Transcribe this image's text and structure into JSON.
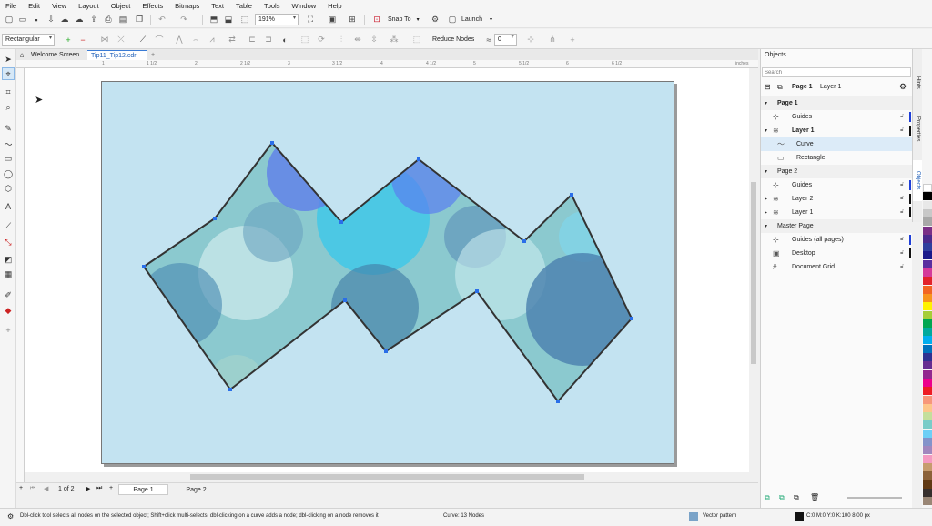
{
  "menu": [
    "File",
    "Edit",
    "View",
    "Layout",
    "Object",
    "Effects",
    "Bitmaps",
    "Text",
    "Table",
    "Tools",
    "Window",
    "Help"
  ],
  "toolbar": {
    "zoom_value": "191%",
    "snap_to": "Snap To",
    "launch": "Launch"
  },
  "propertybar": {
    "selection_mode": "Rectangular",
    "reduce_nodes": "Reduce Nodes",
    "smoothness_value": "0"
  },
  "doc_tabs": [
    "Welcome Screen",
    "Tip11_Tip12.cdr"
  ],
  "ruler": {
    "ticks": [
      "1",
      "1 1/2",
      "2",
      "2 1/2",
      "3",
      "3 1/2",
      "4",
      "4 1/2",
      "5",
      "5 1/2",
      "6",
      "6 1/2"
    ],
    "units": "inches"
  },
  "page_nav": {
    "counter": "1 of 2",
    "tabs": [
      "Page 1",
      "Page 2"
    ]
  },
  "objects_panel": {
    "title": "Objects",
    "search_placeholder": "Search",
    "header_page": "Page 1",
    "header_layer": "Layer 1",
    "rows": [
      {
        "label": "Page 1",
        "bold": true,
        "arrow": "▾",
        "icon": ""
      },
      {
        "label": "Guides",
        "bold": false,
        "arrow": "",
        "icon": "⊹",
        "lock": true,
        "bar": "#1f3fd8"
      },
      {
        "label": "Layer 1",
        "bold": true,
        "arrow": "▾",
        "icon": "≋",
        "lock": true,
        "bar": "#111111"
      },
      {
        "label": "Curve",
        "bold": false,
        "arrow": "",
        "icon": "〜",
        "indent": true,
        "selected": true
      },
      {
        "label": "Rectangle",
        "bold": false,
        "arrow": "",
        "icon": "▭",
        "indent": true
      },
      {
        "label": "Page 2",
        "bold": false,
        "arrow": "▾",
        "icon": ""
      },
      {
        "label": "Guides",
        "bold": false,
        "arrow": "",
        "icon": "⊹",
        "lock": true,
        "bar": "#1f3fd8"
      },
      {
        "label": "Layer 2",
        "bold": false,
        "arrow": "▸",
        "icon": "≋",
        "lock": true,
        "bar": "#111111"
      },
      {
        "label": "Layer 1",
        "bold": false,
        "arrow": "▸",
        "icon": "≋",
        "lock": true,
        "bar": "#111111"
      },
      {
        "label": "Master Page",
        "bold": false,
        "arrow": "▾",
        "icon": ""
      },
      {
        "label": "Guides (all pages)",
        "bold": false,
        "arrow": "",
        "icon": "⊹",
        "lock": true,
        "bar": "#1f3fd8"
      },
      {
        "label": "Desktop",
        "bold": false,
        "arrow": "",
        "icon": "▣",
        "lock": true,
        "bar": "#111111"
      },
      {
        "label": "Document Grid",
        "bold": false,
        "arrow": "",
        "icon": "#",
        "lock": true
      }
    ]
  },
  "dock_tabs": [
    "Hints",
    "Properties",
    "Objects"
  ],
  "status": {
    "hint": "Dbl-click tool selects all nodes on the selected object; Shift+click multi-selects; dbl-clicking on a curve adds a node; dbl-clicking on a node removes it",
    "info": "Curve: 13 Nodes",
    "fill": "Vector pattern",
    "outline": "C:0 M:0 Y:0 K:100  8.00 px"
  },
  "colors": {
    "page": "#c3e3f1",
    "accent": "#1f6fd8",
    "outline": "#333333"
  },
  "palette": [
    "#ffffff",
    "#000000",
    "#e8e8e8",
    "#c8c8c8",
    "#a8a8a8",
    "#7a2f86",
    "#4a2a8c",
    "#2e3f9e",
    "#1a1a8a",
    "#5a2ea0",
    "#d43a9a",
    "#e2222a",
    "#f26522",
    "#f7941d",
    "#fff200",
    "#a6ce39",
    "#00a651",
    "#00a99d",
    "#00aeef",
    "#0072bc",
    "#2e3192",
    "#662d91",
    "#92278f",
    "#ec008c",
    "#ed1c24",
    "#f7977a",
    "#fdc68a",
    "#c4df9b",
    "#7accc8",
    "#6dcff6",
    "#8393ca",
    "#a187be",
    "#f49ac1",
    "#c69c6d",
    "#8c6239",
    "#603913",
    "#362f2d",
    "#998675"
  ]
}
